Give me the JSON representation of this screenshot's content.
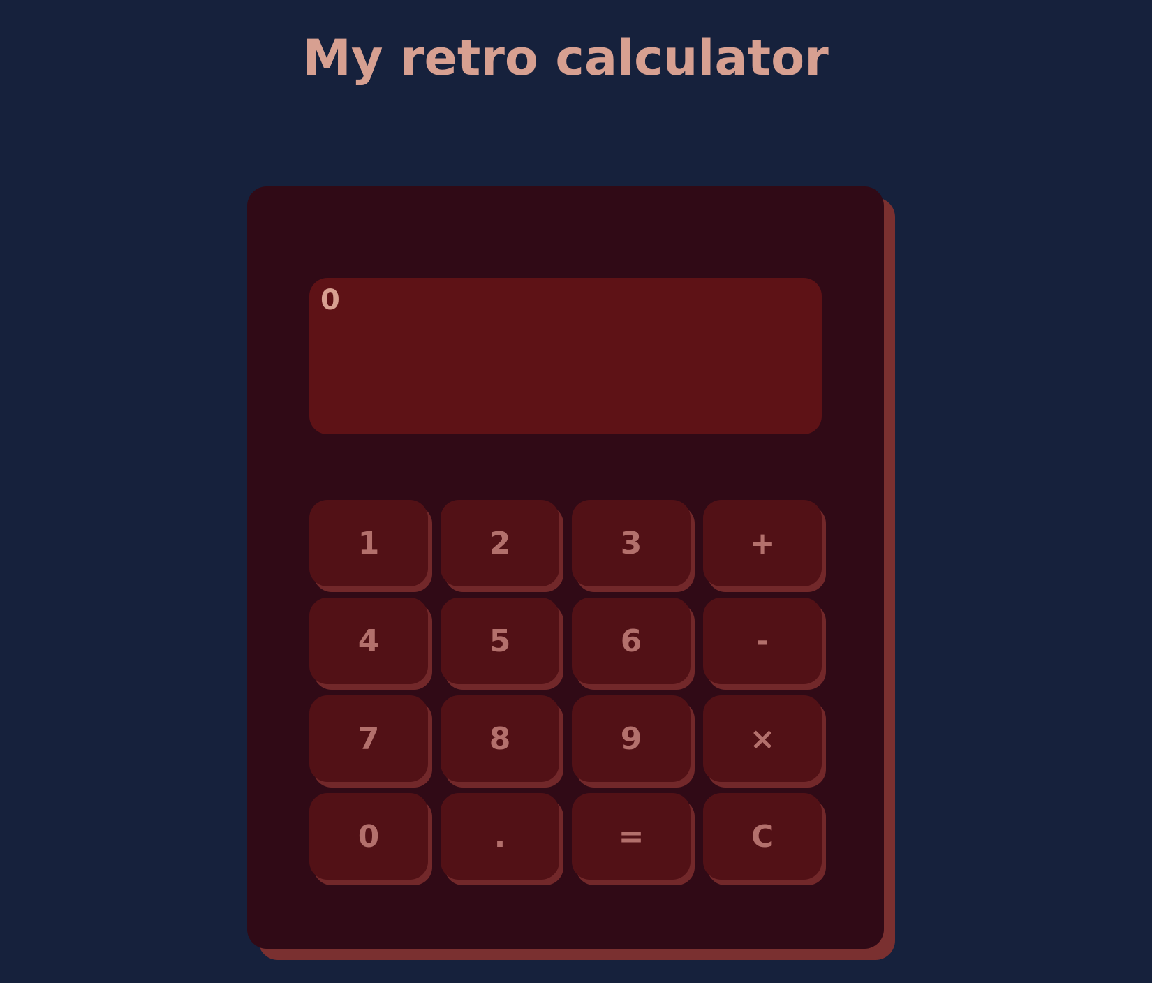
{
  "header": {
    "title": "My retro calculator"
  },
  "display": {
    "value": "0"
  },
  "keys": [
    {
      "label": "1",
      "name": "key-1"
    },
    {
      "label": "2",
      "name": "key-2"
    },
    {
      "label": "3",
      "name": "key-3"
    },
    {
      "label": "+",
      "name": "key-plus"
    },
    {
      "label": "4",
      "name": "key-4"
    },
    {
      "label": "5",
      "name": "key-5"
    },
    {
      "label": "6",
      "name": "key-6"
    },
    {
      "label": "-",
      "name": "key-minus"
    },
    {
      "label": "7",
      "name": "key-7"
    },
    {
      "label": "8",
      "name": "key-8"
    },
    {
      "label": "9",
      "name": "key-9"
    },
    {
      "label": "×",
      "name": "key-multiply"
    },
    {
      "label": "0",
      "name": "key-0"
    },
    {
      "label": ".",
      "name": "key-decimal"
    },
    {
      "label": "=",
      "name": "key-equals"
    },
    {
      "label": "C",
      "name": "key-clear"
    }
  ],
  "colors": {
    "background": "#16213c",
    "body": "#300a16",
    "body_shadow": "#7a3030",
    "display": "#5e1216",
    "key": "#521116",
    "key_shadow": "#72282a",
    "key_text": "#b3706c",
    "title_text": "#d7a091"
  }
}
